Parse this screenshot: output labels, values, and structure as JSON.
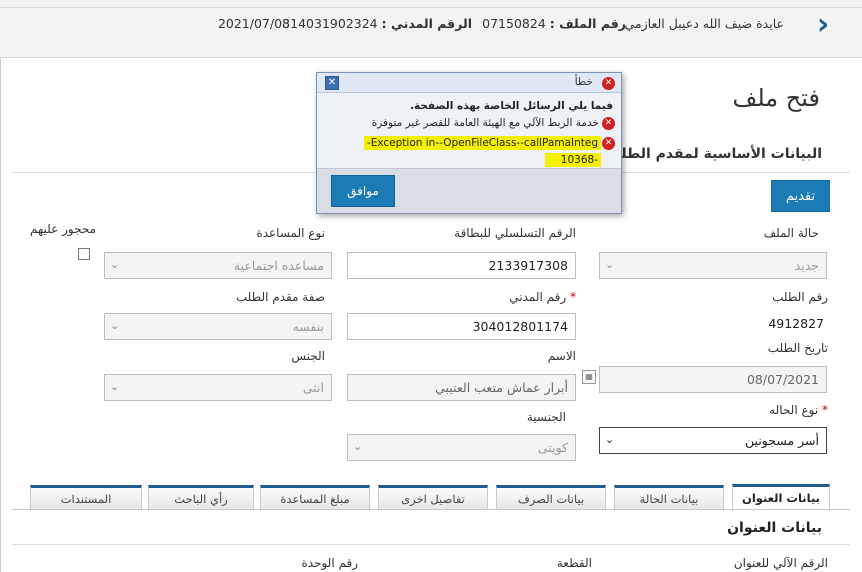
{
  "header": {
    "name": "عايدة ضيف الله دعيبل العازمي",
    "file_no_label": "رقم الملف :",
    "file_no": "07150824",
    "civil_id_label": "الرقم المدني :",
    "civil_id": "314031902324",
    "date": "2021/07/08"
  },
  "page": {
    "title": "فتح ملف",
    "section_title": "البيانات الأساسية لمقدم الطلب",
    "submit_label": "تقديم"
  },
  "form": {
    "file_status_label": "حالة الملف",
    "file_status_value": "جديد",
    "card_serial_label": "الرقم التسلسلي للبطاقة",
    "card_serial_value": "2133917308",
    "aid_type_label": "نوع المساعدة",
    "aid_type_value": "مساعده اجتماعية",
    "interdicted_label": "محجور عليهم",
    "request_no_label": "رقم الطلب",
    "request_no_value": "4912827",
    "civil_no_label": "رقم المدني",
    "civil_no_value": "304012801174",
    "applicant_capacity_label": "صفة مقدم الطلب",
    "applicant_capacity_value": "بنفسه",
    "request_date_label": "تاريخ الطلب",
    "request_date_value": "08/07/2021",
    "name_label": "الاسم",
    "name_value": "أبرار عماش متعب العتيبي",
    "gender_label": "الجنس",
    "gender_value": "انثى",
    "case_type_label": "نوع الحاله",
    "case_type_value": "أسر مسجونين",
    "nationality_label": "الجنسية",
    "nationality_value": "كويتى",
    "required_mark": "*"
  },
  "tabs": [
    {
      "label": "بيانات العنوان"
    },
    {
      "label": "بيانات الحالة"
    },
    {
      "label": "بيانات الصرف"
    },
    {
      "label": "تفاصيل اخرى"
    },
    {
      "label": "مبلغ المساعدة"
    },
    {
      "label": "رأي الباحث"
    },
    {
      "label": "المستندات"
    }
  ],
  "address": {
    "title": "بيانات العنوان",
    "auto_no_label": "الرقم الآلي للعنوان",
    "block_label": "القطعة",
    "unit_no_label": "رقم الوحدة"
  },
  "dialog": {
    "title": "خطأ",
    "intro": "فيما يلي الرسائل الخاصة بهذه الصفحة.",
    "msg1": "خدمة الربط الآلي مع الهيئة العامة للقصر غير متوفرة",
    "msg2_line1": "Exception in--OpenFileClass--callPamaInteg-",
    "msg2_line2": "-10368",
    "ok_label": "موافق"
  }
}
